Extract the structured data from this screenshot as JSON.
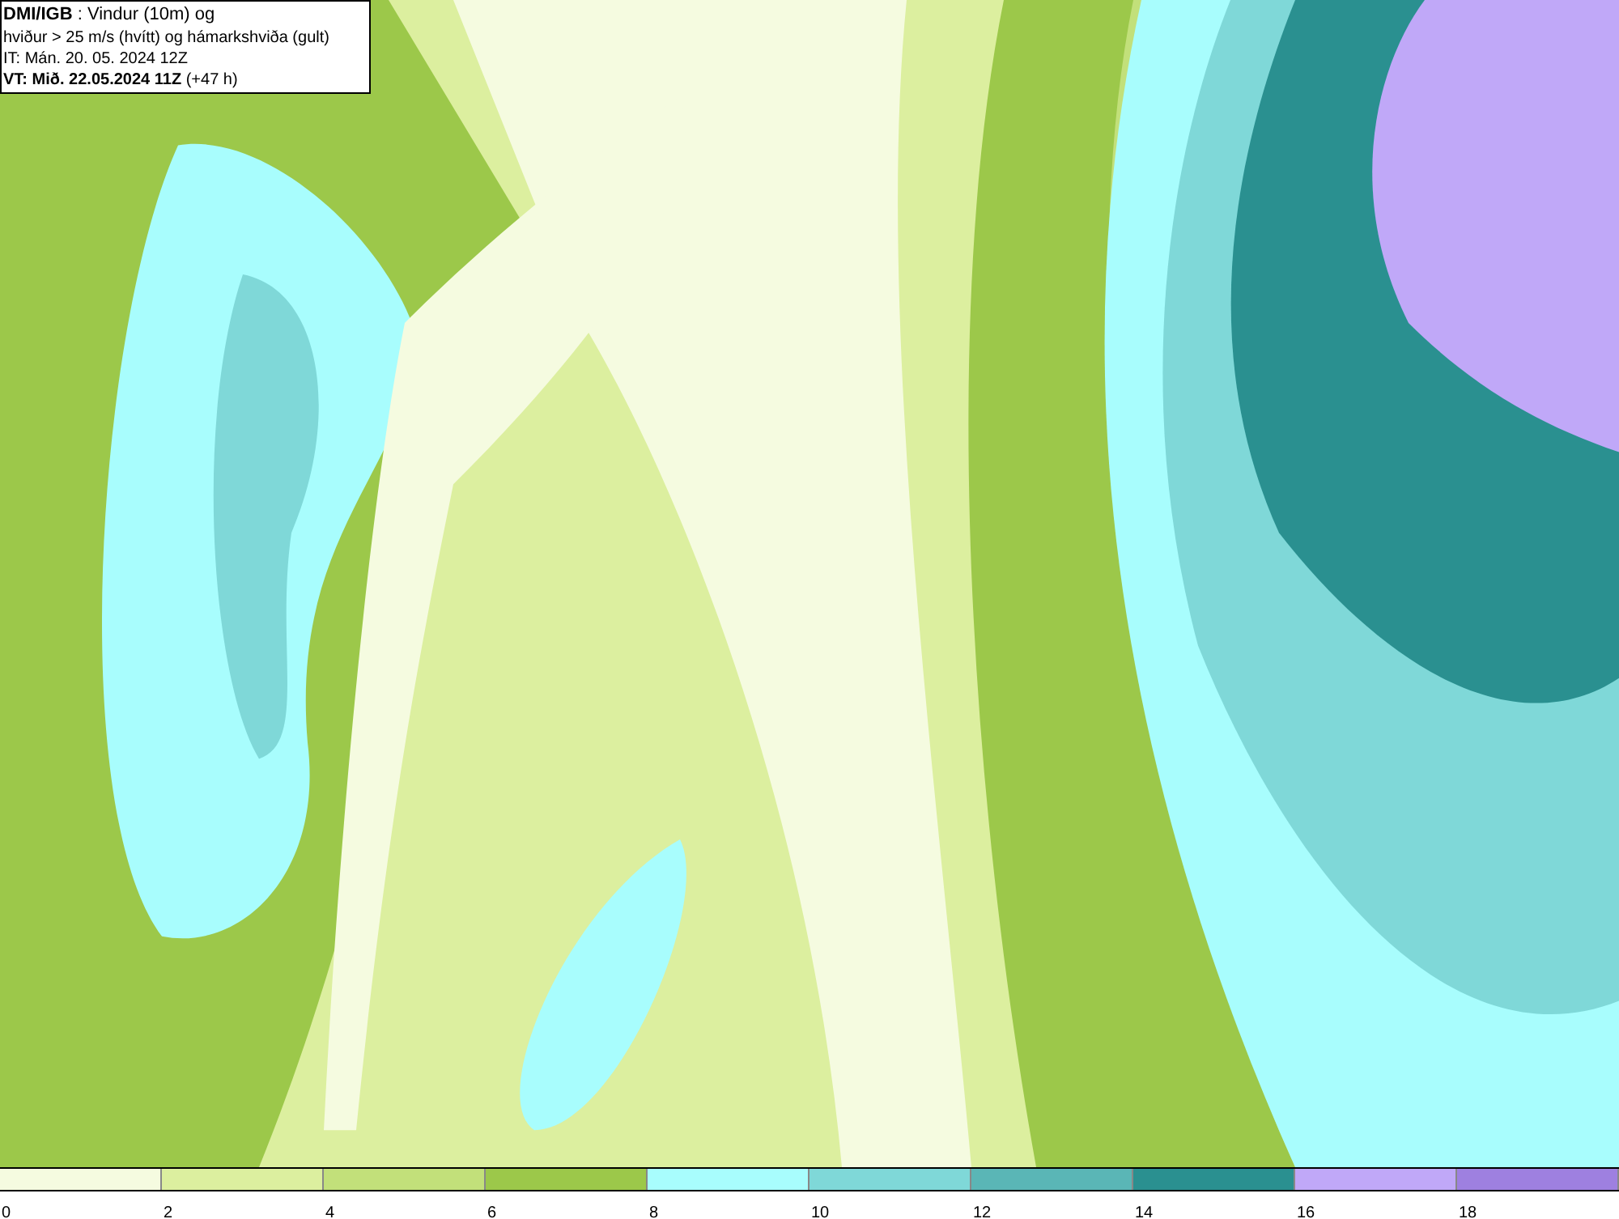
{
  "title_box": {
    "lines": [
      "**DMI/IGB** : Vindur (10m) og",
      "hviður > 25 m/s (hvítt) og hámarkshviða (gult)",
      "IT: Mán. 20. 05. 2024 12Z",
      "**VT: Mið. 22.05.2024 11Z** (+47 h)"
    ]
  },
  "legend": [
    {
      "label": "0",
      "color": "#f5fbe0"
    },
    {
      "label": "2",
      "color": "#dcef9f"
    },
    {
      "label": "4",
      "color": "#c2e07a"
    },
    {
      "label": "6",
      "color": "#9cc84a"
    },
    {
      "label": "8",
      "color": "#a8fdfd"
    },
    {
      "label": "10",
      "color": "#7fd8d8"
    },
    {
      "label": "12",
      "color": "#5ab6b6"
    },
    {
      "label": "14",
      "color": "#2a9090"
    },
    {
      "label": "16",
      "color": "#c0a8f8"
    },
    {
      "label": "18",
      "color": "#9e80e0"
    }
  ]
}
